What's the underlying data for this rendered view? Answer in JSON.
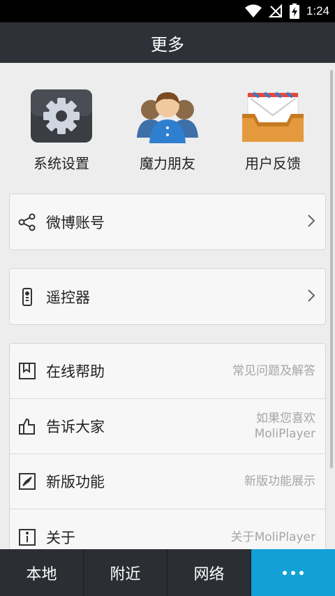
{
  "status": {
    "time": "1:24"
  },
  "header": {
    "title": "更多"
  },
  "quick": [
    {
      "label": "系统设置",
      "icon": "gear-icon"
    },
    {
      "label": "魔力朋友",
      "icon": "friends-icon"
    },
    {
      "label": "用户反馈",
      "icon": "mail-tray-icon"
    }
  ],
  "weibo": {
    "label": "微博账号",
    "icon": "share-icon"
  },
  "remote": {
    "label": "遥控器",
    "icon": "remote-icon"
  },
  "list": {
    "help": {
      "label": "在线帮助",
      "sub": "常见问题及解答"
    },
    "share": {
      "label": "告诉大家",
      "sub1": "如果您喜欢",
      "sub2": "MoliPlayer"
    },
    "features": {
      "label": "新版功能",
      "sub": "新版功能展示"
    },
    "about": {
      "label": "关于",
      "sub": "关于MoliPlayer"
    }
  },
  "tabs": [
    {
      "label": "本地"
    },
    {
      "label": "附近"
    },
    {
      "label": "网络"
    }
  ],
  "colors": {
    "accent": "#12a0d7",
    "titlebar": "#2e3238",
    "tabbar": "#2b2e33"
  }
}
